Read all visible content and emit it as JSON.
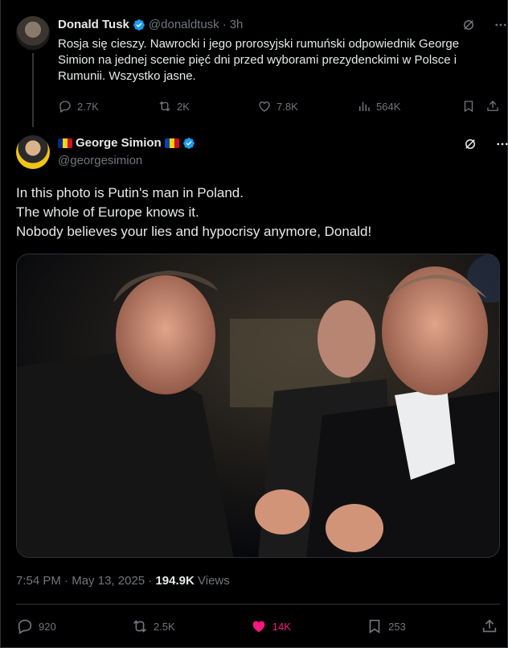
{
  "parent_tweet": {
    "author_name": "Donald Tusk",
    "handle": "@donaldtusk",
    "separator": "·",
    "time": "3h",
    "text": "Rosja się cieszy. Nawrocki i jego prorosyjski rumuński odpowiednik George Simion na jednej scenie pięć dni przed wyborami prezydenckimi w Polsce i Rumunii. Wszystko jasne.",
    "replies": "2.7K",
    "reposts": "2K",
    "likes": "7.8K",
    "views": "564K"
  },
  "main_tweet": {
    "author_name": "George Simion",
    "handle": "@georgesimion",
    "text_lines": [
      "In this photo is Putin's man in Poland.",
      "The whole of Europe knows it.",
      "Nobody believes your lies and hypocrisy anymore, Donald!"
    ],
    "time": "7:54 PM",
    "date": "May 13, 2025",
    "views_count": "194.9K",
    "views_label": "Views",
    "replies": "920",
    "reposts": "2.5K",
    "likes": "14K",
    "bookmarks": "253"
  },
  "colors": {
    "background": "#000000",
    "text_primary": "#e7e9ea",
    "text_secondary": "#71767b",
    "verified_blue": "#1d9bf0",
    "like_pink": "#f91880",
    "romania_flag": [
      "#002b7f",
      "#fcd116",
      "#ce1126"
    ],
    "moldova_flag": [
      "#0046ae",
      "#ffd200",
      "#cc092f"
    ]
  },
  "icons": {
    "verified": "verified-badge-icon",
    "grok": "grok-icon",
    "more": "more-icon",
    "reply": "reply-icon",
    "repost": "repost-icon",
    "like": "heart-icon",
    "views": "views-icon",
    "bookmark": "bookmark-icon",
    "share": "share-icon"
  }
}
